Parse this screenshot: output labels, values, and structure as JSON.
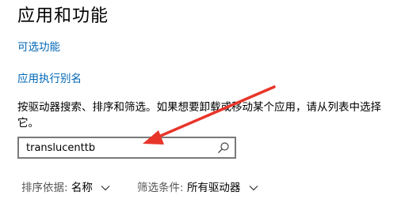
{
  "page": {
    "title": "应用和功能"
  },
  "links": {
    "optional_features": "可选功能",
    "app_execution_alias": "应用执行别名"
  },
  "description": "按驱动器搜索、排序和筛选。如果想要卸载或移动某个应用，请从列表中选择它。",
  "search": {
    "value": "translucenttb"
  },
  "filters": {
    "sort_label": "排序依据:",
    "sort_value": "名称",
    "filter_label": "筛选条件:",
    "filter_value": "所有驱动器"
  },
  "colors": {
    "link": "#0067b8",
    "annotation_arrow": "#e8352a",
    "search_border": "#7a7a7a"
  },
  "icons": {
    "search": "search-icon",
    "chevron": "chevron-down-icon"
  }
}
